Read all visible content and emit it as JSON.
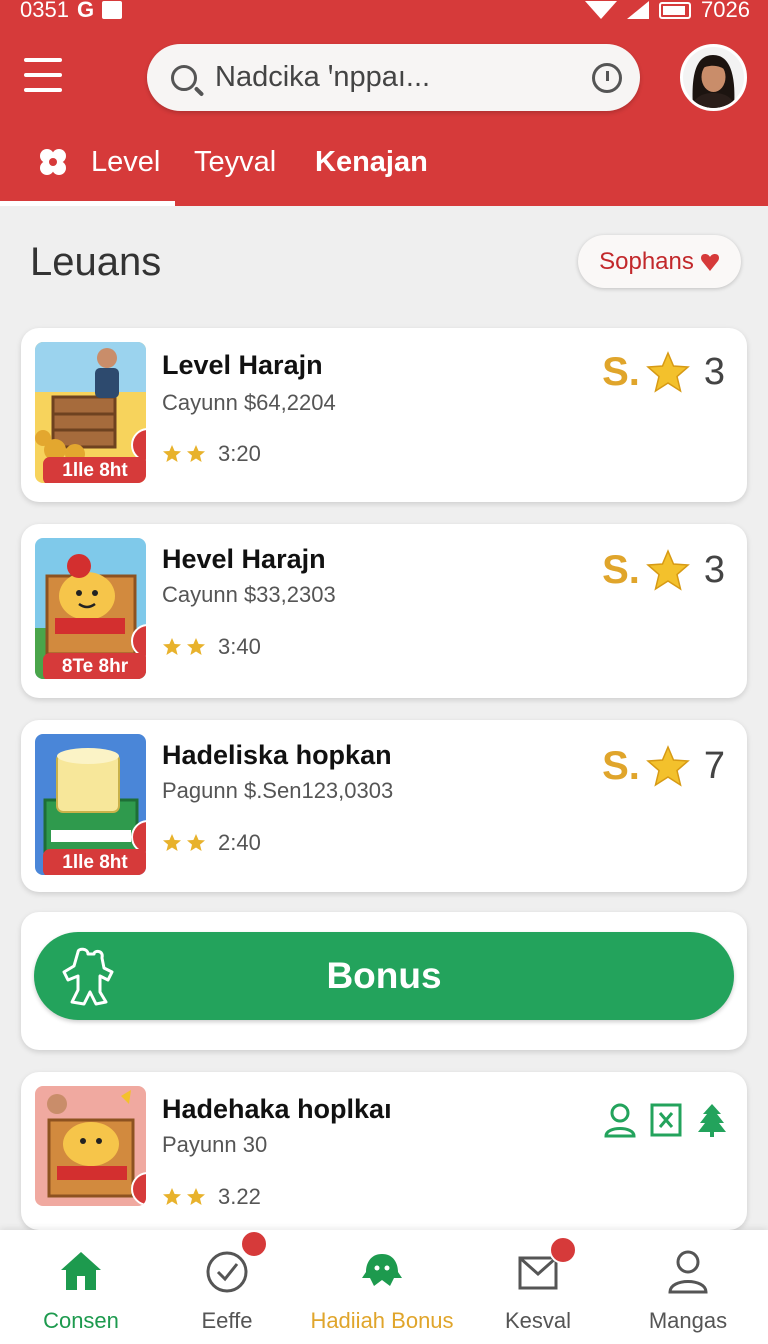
{
  "status_bar": {
    "time": "0351",
    "network_letter": "G",
    "battery_text": "7026"
  },
  "search": {
    "placeholder": "Nadcika ꞌnppaı..."
  },
  "tabs": [
    {
      "label": "Level"
    },
    {
      "label": "Teyval"
    },
    {
      "label": "Kenajan"
    }
  ],
  "section": {
    "title": "Leuans",
    "chip_label": "Sophans"
  },
  "cards": [
    {
      "title": "Level Harajn",
      "subtitle": "Cayunn $64,2204",
      "rating": "3:20",
      "badge": "1lle 8ht",
      "s_mark": "S.",
      "count": "3"
    },
    {
      "title": "Hevel Harajn",
      "subtitle": "Cayunn $33,2303",
      "rating": "3:40",
      "badge": "8Te 8hr",
      "s_mark": "S.",
      "count": "3"
    },
    {
      "title": "Hadeliska hopkan",
      "subtitle": "Pagunn $.Sen123,0303",
      "rating": "2:40",
      "badge": "1lle 8ht",
      "s_mark": "S.",
      "count": "7"
    },
    {
      "title": "Hadehaka hoplkaı",
      "subtitle": "Payunn 30",
      "rating": "3.22"
    }
  ],
  "bonus": {
    "label": "Bonus"
  },
  "bottom_nav": [
    {
      "label": "Consen",
      "icon": "home-icon"
    },
    {
      "label": "Eeffe",
      "icon": "check-circle-icon"
    },
    {
      "label": "Hadiiah Bonus",
      "icon": "bonus-icon"
    },
    {
      "label": "Kesval",
      "icon": "mail-icon"
    },
    {
      "label": "Mangas",
      "icon": "user-icon"
    }
  ],
  "colors": {
    "brand_red": "#d63a3a",
    "green": "#23a35c",
    "gold": "#e0a52b",
    "active_label": "#e0a52b",
    "home_label": "#1d9a4e"
  }
}
